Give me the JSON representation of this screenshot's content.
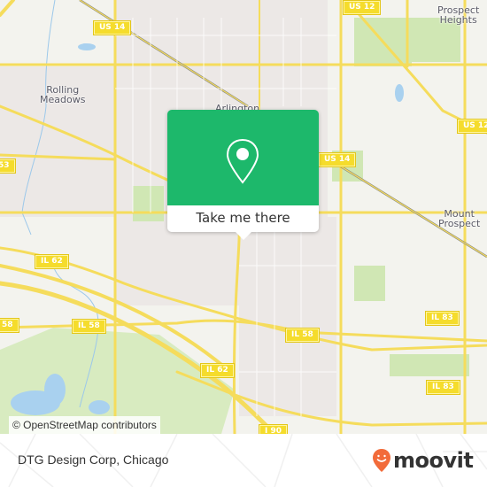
{
  "map": {
    "place_labels": [
      {
        "id": "rolling-meadows",
        "lines": [
          "Rolling",
          "Meadows"
        ]
      },
      {
        "id": "arlington",
        "lines": [
          "Arlington"
        ]
      },
      {
        "id": "prospect-heights",
        "lines": [
          "Prospect",
          "Heights"
        ]
      },
      {
        "id": "mount-prospect",
        "lines": [
          "Mount",
          "Prospect"
        ]
      }
    ],
    "road_shields": [
      {
        "id": "us14-top",
        "label": "US 14"
      },
      {
        "id": "us12-top",
        "label": "US 12"
      },
      {
        "id": "us12-right",
        "label": "US 12"
      },
      {
        "id": "us14-mid",
        "label": "US 14"
      },
      {
        "id": "53-left",
        "label": "53"
      },
      {
        "id": "il62-left",
        "label": "IL 62"
      },
      {
        "id": "il58-left",
        "label": "58"
      },
      {
        "id": "il58-mid",
        "label": "IL 58"
      },
      {
        "id": "il58-right",
        "label": "IL 58"
      },
      {
        "id": "il83-upper",
        "label": "IL 83"
      },
      {
        "id": "il83-lower",
        "label": "IL 83"
      },
      {
        "id": "il62-lower",
        "label": "IL 62"
      },
      {
        "id": "i90",
        "label": "I 90"
      }
    ],
    "attribution": "© OpenStreetMap contributors"
  },
  "popup": {
    "icon": "map-pin-icon",
    "button_label": "Take me there",
    "color": "#1db86b"
  },
  "footer": {
    "place_name": "DTG Design Corp, Chicago",
    "brand": "moovit",
    "brand_color": "#f26b3a"
  }
}
